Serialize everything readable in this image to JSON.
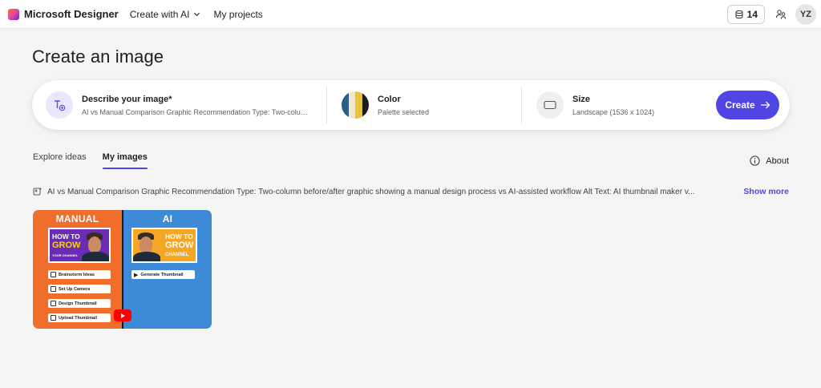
{
  "header": {
    "app_name": "Microsoft Designer",
    "nav": {
      "create_with_ai": "Create with AI",
      "my_projects": "My projects"
    },
    "credits": "14",
    "avatar_initials": "YZ"
  },
  "page": {
    "title": "Create an image"
  },
  "prompt_card": {
    "describe": {
      "label": "Describe your image*",
      "value": "AI vs Manual Comparison Graphic Recommendation Type: Two-column before/after graphic showing a manual design process vs AI-assisted workflow Alt Text: AI thumbnail maker v..."
    },
    "color": {
      "label": "Color",
      "value": "Palette selected",
      "palette": [
        "#2b5d8a",
        "#f2e8c9",
        "#e8c23a",
        "#1c1c1c"
      ]
    },
    "size": {
      "label": "Size",
      "value": "Landscape (1536 x 1024)"
    },
    "create_label": "Create"
  },
  "tabs": [
    {
      "label": "Explore ideas",
      "active": false
    },
    {
      "label": "My images",
      "active": true
    }
  ],
  "about_label": "About",
  "prompt_line": {
    "text": "AI vs Manual Comparison Graphic Recommendation Type: Two-column before/after graphic showing a manual design process vs AI-assisted workflow Alt Text: AI thumbnail maker v...",
    "show_more": "Show more"
  },
  "thumbnail": {
    "left_title": "MANUAL",
    "right_title": "AI",
    "card_line1": "HOW TO",
    "card_line2": "GROW",
    "card_line3": "YOUR CHANNEL",
    "card_right_line3": "CHANNEL",
    "steps": [
      "Brainstorm Ideas",
      "Set Up Camera",
      "Design Thumbnail",
      "Upload Thumbnail"
    ],
    "ai_step": "Generate Thumbnail"
  },
  "colors": {
    "accent": "#4f46e5",
    "manual_bg": "#f06d2c",
    "ai_bg": "#3d8bd6"
  }
}
